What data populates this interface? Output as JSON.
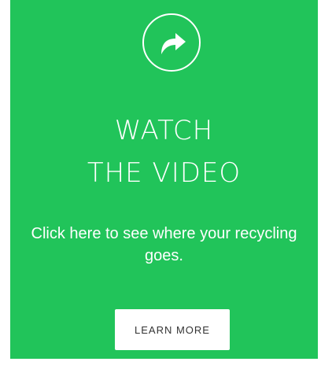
{
  "card": {
    "background_color": "#21c45a",
    "icon": "share-arrow-icon",
    "headline_line1": "WATCH",
    "headline_line2": "THE VIDEO",
    "description": "Click here to see where your recycling goes.",
    "button_label": "LEARN MORE"
  }
}
